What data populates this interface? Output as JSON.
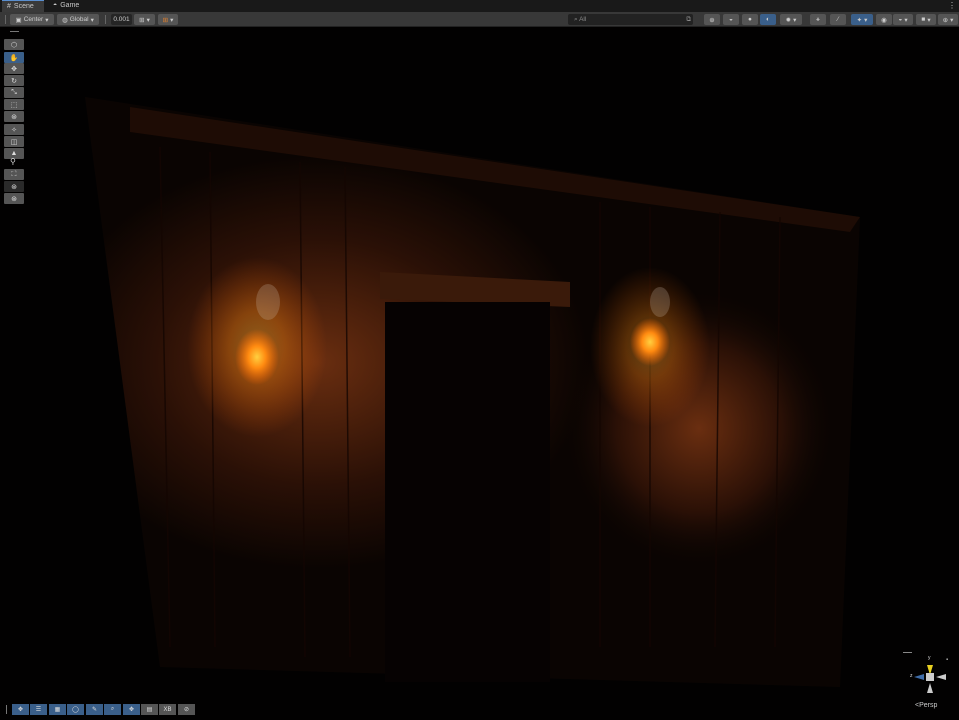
{
  "tabs": [
    {
      "label": "Scene",
      "icon": "grid-icon"
    },
    {
      "label": "Game",
      "icon": "gamepad-icon"
    }
  ],
  "toolbar": {
    "pivot_mode": "Center",
    "pivot_rotation": "Global",
    "snap_increment": "0.001",
    "search_placeholder": "All"
  },
  "left_tools": [
    "view-tool",
    "hand-tool",
    "move-tool",
    "rotate-tool",
    "scale-tool",
    "rect-tool",
    "transform-tool",
    "custom-tool-1",
    "custom-tool-2",
    "custom-tool-3",
    "custom-tool-4",
    "custom-tool-5",
    "custom-tool-6",
    "custom-tool-7"
  ],
  "bottom_tools": {
    "xb_label": "XB"
  },
  "gizmo": {
    "y": "y",
    "z": "z",
    "projection": "Persp"
  },
  "colors": {
    "accent": "#3a5f8a",
    "fire": "#ff9a1a"
  }
}
